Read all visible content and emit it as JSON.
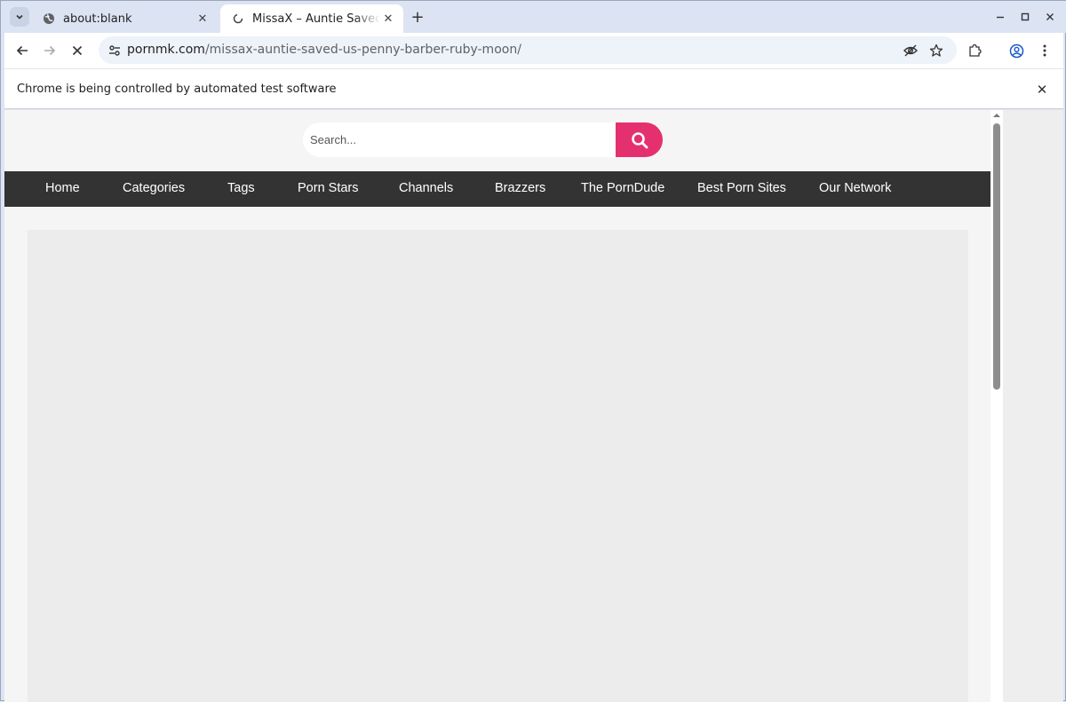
{
  "browser": {
    "tabs": [
      {
        "title": "about:blank",
        "close": "✕"
      },
      {
        "title": "MissaX – Auntie Saved Us",
        "close": "✕"
      }
    ],
    "new_tab": "+",
    "window_controls": {
      "minimize": "–",
      "maximize": "☐",
      "close": "✕"
    },
    "url": {
      "domain": "pornmk.com",
      "path": "/missax-auntie-saved-us-penny-barber-ruby-moon/"
    },
    "infobar": {
      "text": "Chrome is being controlled by automated test software",
      "close": "✕"
    }
  },
  "site": {
    "search": {
      "placeholder": "Search..."
    },
    "accent_color": "#e5306f",
    "nav_background": "#333333",
    "nav": [
      "Home",
      "Categories",
      "Tags",
      "Porn Stars",
      "Channels",
      "Brazzers",
      "The PornDude",
      "Best Porn Sites",
      "Our Network"
    ],
    "nav_icons": [
      "home-icon",
      "folder-icon",
      "tag-icon",
      "star-icon",
      "tv-icon"
    ]
  }
}
